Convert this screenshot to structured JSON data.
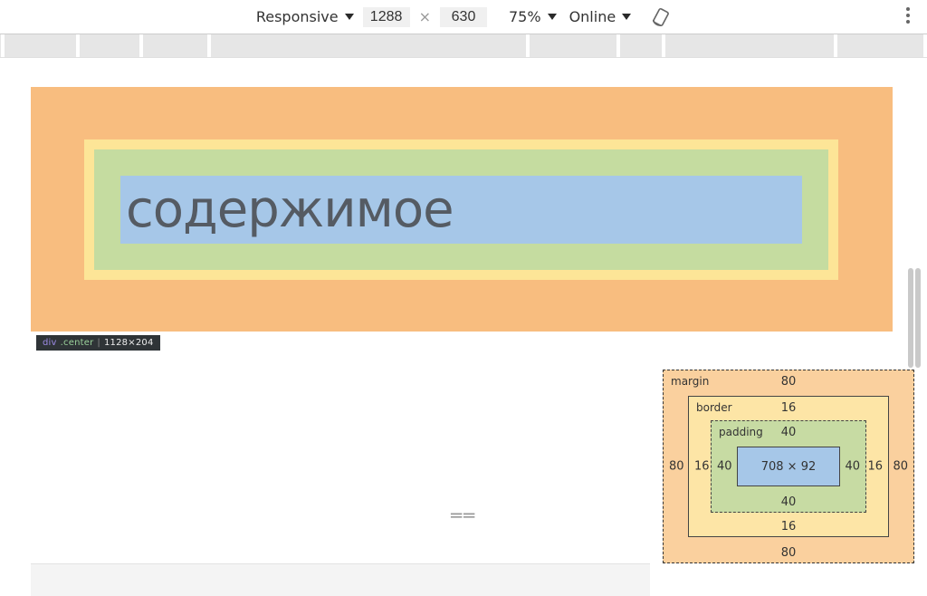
{
  "toolbar": {
    "device_label": "Responsive",
    "width": "1288",
    "height": "630",
    "zoom": "75%",
    "throttle": "Online"
  },
  "page": {
    "content_text": "содержимое"
  },
  "tooltip": {
    "tag": "div",
    "class": ".center",
    "dims": "1128×204"
  },
  "box_model": {
    "margin_label": "margin",
    "border_label": "border",
    "padding_label": "padding",
    "margin": {
      "t": "80",
      "r": "80",
      "b": "80",
      "l": "80"
    },
    "border": {
      "t": "16",
      "r": "16",
      "b": "16",
      "l": "16"
    },
    "padding": {
      "t": "40",
      "r": "40",
      "b": "40",
      "l": "40"
    },
    "content": "708 × 92"
  }
}
